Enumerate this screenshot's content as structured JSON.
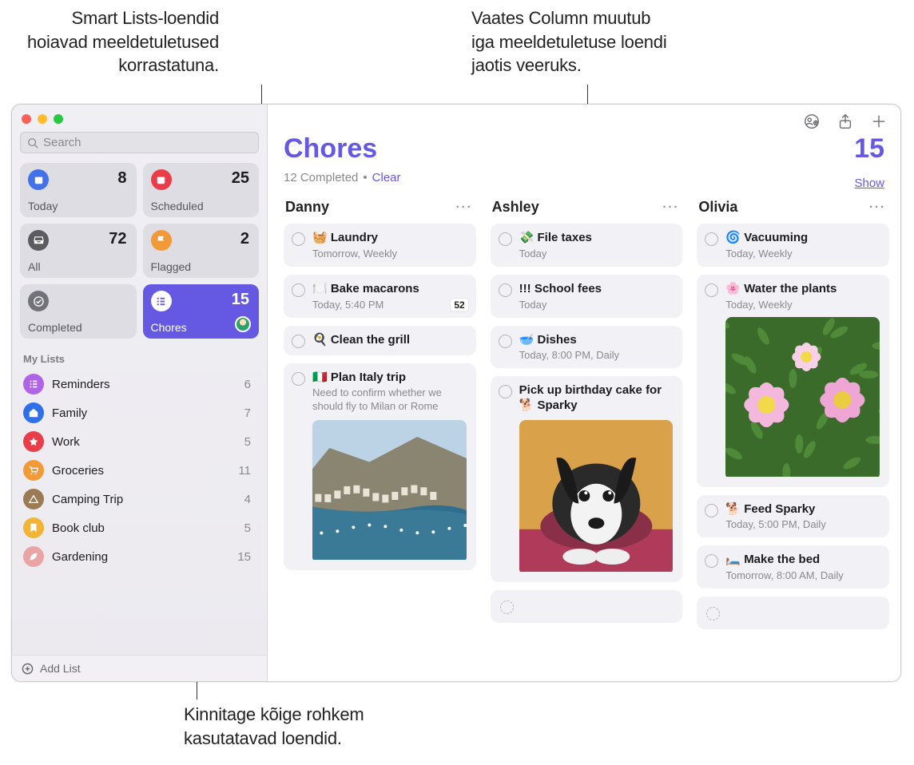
{
  "callouts": {
    "smart_lists": "Smart Lists-loendid\nhoiavad meeldetuletused\nkorrastatuna.",
    "column_view": "Vaates Column muutub\niga meeldetuletuse loendi\njaotis veeruks.",
    "pin_lists": "Kinnitage kõige rohkem\nkasutatavad loendid."
  },
  "search": {
    "placeholder": "Search"
  },
  "smart": [
    {
      "label": "Today",
      "count": 8,
      "icon": "calendar",
      "bg": "#4272ea"
    },
    {
      "label": "Scheduled",
      "count": 25,
      "icon": "calendar",
      "bg": "#e93d4a"
    },
    {
      "label": "All",
      "count": 72,
      "icon": "inbox",
      "bg": "#5b5b60"
    },
    {
      "label": "Flagged",
      "count": 2,
      "icon": "flag",
      "bg": "#f19a37"
    },
    {
      "label": "Completed",
      "count": "",
      "icon": "check",
      "bg": "#72727a"
    },
    {
      "label": "Chores",
      "count": 15,
      "icon": "list",
      "bg": "#6558e2",
      "active": true,
      "shared": true
    }
  ],
  "section_label": "My Lists",
  "lists": [
    {
      "label": "Reminders",
      "count": 6,
      "bg": "#b163e8",
      "icon": "list"
    },
    {
      "label": "Family",
      "count": 7,
      "bg": "#2f6fe9",
      "icon": "home"
    },
    {
      "label": "Work",
      "count": 5,
      "bg": "#e93d4a",
      "icon": "star"
    },
    {
      "label": "Groceries",
      "count": 11,
      "bg": "#f19a37",
      "icon": "cart"
    },
    {
      "label": "Camping Trip",
      "count": 4,
      "bg": "#9b7b55",
      "icon": "tent"
    },
    {
      "label": "Book club",
      "count": 5,
      "bg": "#f1b437",
      "icon": "bookmark"
    },
    {
      "label": "Gardening",
      "count": 15,
      "bg": "#e9a4a4",
      "icon": "leaf"
    }
  ],
  "add_list_label": "Add List",
  "header": {
    "title": "Chores",
    "count": 15,
    "completed_text": "12 Completed",
    "clear": "Clear",
    "show": "Show"
  },
  "columns": [
    {
      "name": "Danny",
      "items": [
        {
          "emoji": "🧺",
          "title": "Laundry",
          "meta": "Tomorrow, Weekly"
        },
        {
          "emoji": "🍽️",
          "title": "Bake macarons",
          "meta": "Today, 5:40 PM",
          "badge": "52"
        },
        {
          "emoji": "🍳",
          "title": "Clean the grill"
        },
        {
          "emoji": "🇮🇹",
          "title": "Plan Italy trip",
          "note": "Need to confirm whether we should fly to Milan or Rome",
          "image": "coast"
        }
      ]
    },
    {
      "name": "Ashley",
      "items": [
        {
          "emoji": "💸",
          "title": "File taxes",
          "meta": "Today"
        },
        {
          "emoji": "",
          "title": "!!! School fees",
          "meta": "Today"
        },
        {
          "emoji": "🥣",
          "title": "Dishes",
          "meta": "Today, 8:00 PM, Daily"
        },
        {
          "emoji": "🐕",
          "title": "Pick up birthday cake for Sparky",
          "wrap": true,
          "image": "dog"
        }
      ],
      "empty": true
    },
    {
      "name": "Olivia",
      "items": [
        {
          "emoji": "🌀",
          "title": "Vacuuming",
          "meta": "Today, Weekly"
        },
        {
          "emoji": "🌸",
          "title": "Water the plants",
          "meta": "Today, Weekly",
          "image": "flowers"
        },
        {
          "emoji": "🐕",
          "title": "Feed Sparky",
          "meta": "Today, 5:00 PM, Daily"
        },
        {
          "emoji": "🛏️",
          "title": "Make the bed",
          "meta": "Tomorrow, 8:00 AM, Daily"
        }
      ],
      "empty": true
    }
  ]
}
